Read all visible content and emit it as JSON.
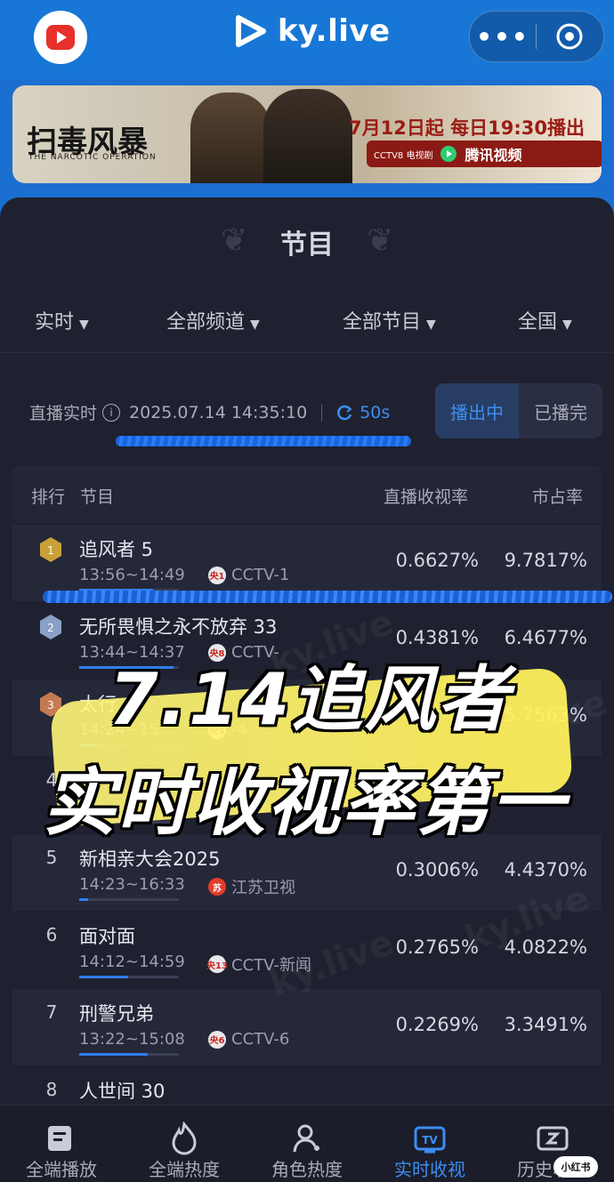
{
  "header": {
    "brand": "ky.live",
    "menu_icon": "more-dots-icon",
    "target_icon": "target-icon"
  },
  "banner": {
    "title": "扫毒风暴",
    "subtitle": "THE NARCOTIC OPERATION",
    "date_text": "7月12日起 每日19:30播出",
    "partner_tv": "CCTV8 电视剧",
    "partner_app": "腾讯视频"
  },
  "panel": {
    "title": "节目",
    "filters": [
      "实时",
      "全部频道",
      "全部节目",
      "全国"
    ]
  },
  "live": {
    "label": "直播实时",
    "timestamp": "2025.07.14 14:35:10",
    "refresh": "50s"
  },
  "segment": {
    "on": "播出中",
    "off": "已播完"
  },
  "table": {
    "headers": {
      "rank": "排行",
      "program": "节目",
      "rating": "直播收视率",
      "share": "市占率"
    },
    "rows": [
      {
        "rank": "1",
        "name": "追风者 5",
        "time": "13:56~14:49",
        "channel": "CCTV-1",
        "icon": "央1",
        "rating": "0.6627%",
        "share": "9.7817%",
        "progress": 0.74
      },
      {
        "rank": "2",
        "name": "无所畏惧之永不放弃 33",
        "time": "13:44~14:37",
        "channel": "CCTV-",
        "icon": "央8",
        "rating": "0.4381%",
        "share": "6.4677%",
        "progress": 0.95
      },
      {
        "rank": "3",
        "name": "太行",
        "time": "14:24~15:",
        "channel": "-4",
        "icon": "央4",
        "rating": "",
        "share": "5.7563%",
        "progress": 0.2
      },
      {
        "rank": "4",
        "name": "",
        "time": "",
        "channel": "",
        "icon": "",
        "rating": "",
        "share": "",
        "progress": 0
      },
      {
        "rank": "5",
        "name": "新相亲大会2025",
        "time": "14:23~16:33",
        "channel": "江苏卫视",
        "icon": "苏",
        "rating": "0.3006%",
        "share": "4.4370%",
        "progress": 0.09
      },
      {
        "rank": "6",
        "name": "面对面",
        "time": "14:12~14:59",
        "channel": "CCTV-新闻",
        "icon": "央13",
        "rating": "0.2765%",
        "share": "4.0822%",
        "progress": 0.49
      },
      {
        "rank": "7",
        "name": "刑警兄弟",
        "time": "13:22~15:08",
        "channel": "CCTV-6",
        "icon": "央6",
        "rating": "0.2269%",
        "share": "3.3491%",
        "progress": 0.69
      },
      {
        "rank": "8",
        "name": "人世间 30",
        "time": "",
        "channel": "",
        "icon": "",
        "rating": "",
        "share": "",
        "progress": 0
      }
    ]
  },
  "overlay": {
    "line1": "7.14追风者",
    "line2": "实时收视率第一"
  },
  "tabs": [
    {
      "label": "全端播放",
      "icon": "play-stats-icon"
    },
    {
      "label": "全端热度",
      "icon": "flame-icon"
    },
    {
      "label": "角色热度",
      "icon": "person-icon"
    },
    {
      "label": "实时收视",
      "icon": "tv-icon",
      "active": true
    },
    {
      "label": "历史收视",
      "icon": "history-icon"
    }
  ],
  "xhs_badge": "小红书",
  "colors": {
    "accent": "#3d8ef0",
    "header": "#1877d6",
    "panel": "#1f2130"
  }
}
